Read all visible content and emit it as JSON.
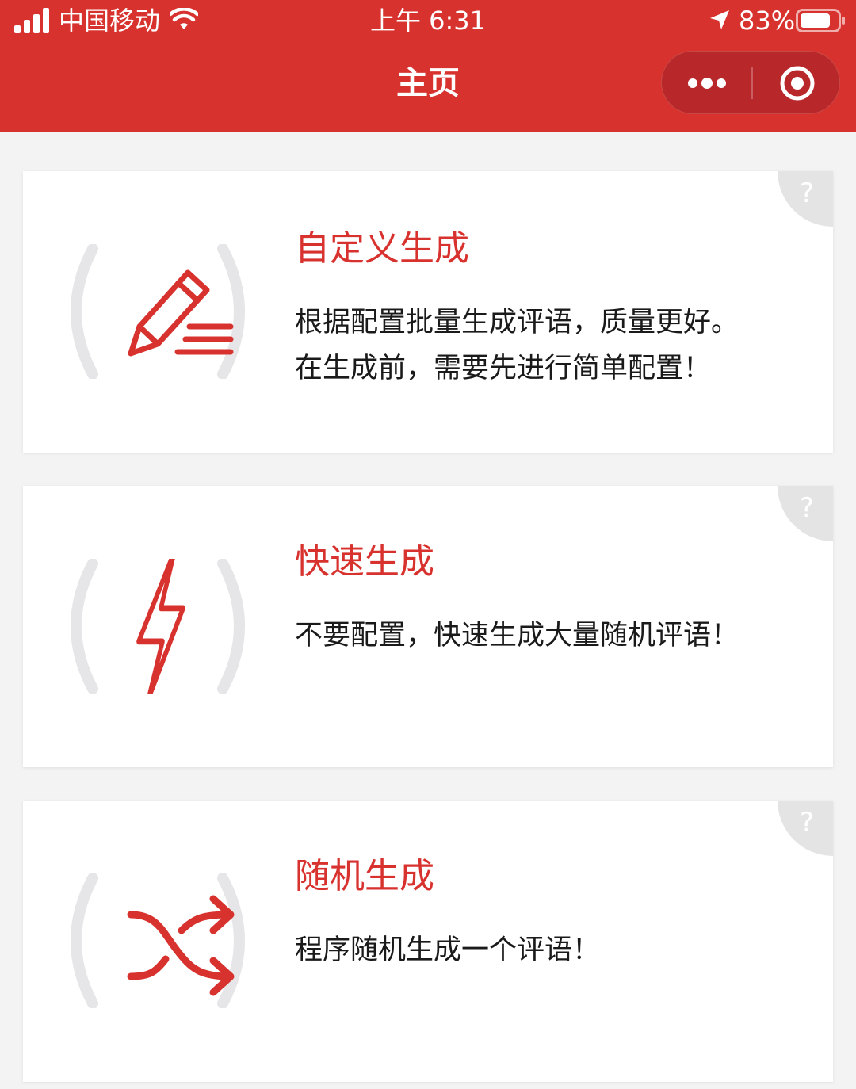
{
  "status_bar": {
    "carrier": "中国移动",
    "time": "上午 6:31",
    "battery_percent": "83%",
    "battery_level": 0.83,
    "signal_bars": 4,
    "icons": [
      "signal-icon",
      "wifi-icon",
      "location-arrow-icon",
      "battery-icon"
    ]
  },
  "header": {
    "title": "主页",
    "background_color": "#d8322f",
    "capsule": {
      "more_icon": "more-dots-icon",
      "close_icon": "target-close-icon"
    }
  },
  "accent_color": "#d8322f",
  "cards": [
    {
      "icon": "pencil-edit-icon",
      "title": "自定义生成",
      "desc_lines": [
        "根据配置批量生成评语，质量更好。",
        "在生成前，需要先进行简单配置！"
      ],
      "help": "?"
    },
    {
      "icon": "lightning-icon",
      "title": "快速生成",
      "desc_lines": [
        "不要配置，快速生成大量随机评语！"
      ],
      "help": "?"
    },
    {
      "icon": "shuffle-icon",
      "title": "随机生成",
      "desc_lines": [
        "程序随机生成一个评语！"
      ],
      "help": "?"
    }
  ]
}
